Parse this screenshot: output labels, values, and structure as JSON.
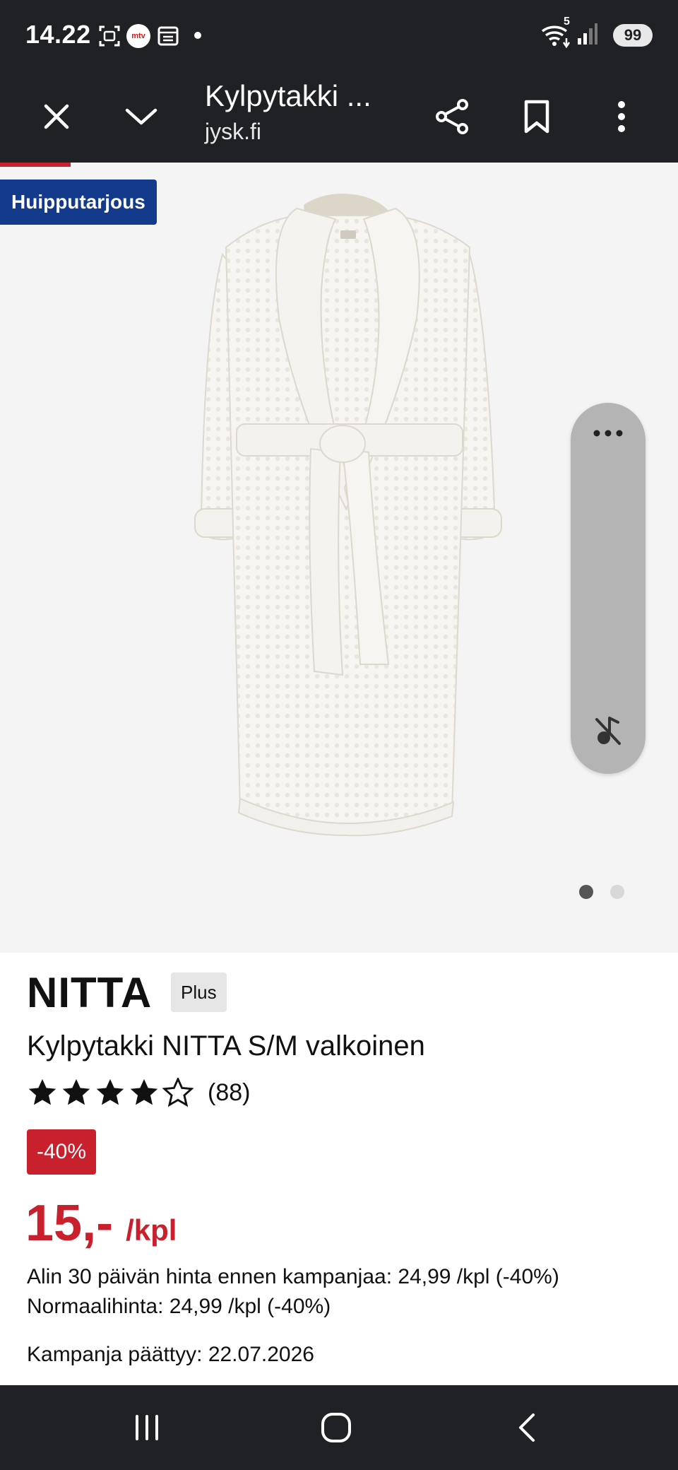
{
  "status_bar": {
    "time": "14.22",
    "icons": [
      "screenshot-icon",
      "mtv-app-icon",
      "calendar-icon",
      "notification-dot"
    ],
    "mtv_label": "mtv",
    "right_icons": [
      "wifi-icon",
      "signal-icon"
    ],
    "wifi_label": "5",
    "battery": "99"
  },
  "toolbar": {
    "title": "Kylpytakki ...",
    "url": "jysk.fi",
    "buttons": [
      "close-icon",
      "chevron-down-icon",
      "share-icon",
      "bookmark-icon",
      "more-vert-icon"
    ]
  },
  "gallery": {
    "promo_badge": "Huipputarjous",
    "image_desc_icon": "bathrobe-image",
    "side_panel_icons": [
      "more-horiz-icon",
      "music-off-icon"
    ],
    "page_count": 2,
    "active_page": 1
  },
  "product": {
    "brand": "NITTA",
    "tier_badge": "Plus",
    "name": "Kylpytakki NITTA S/M valkoinen",
    "rating": 4,
    "rating_max": 5,
    "review_count": "(88)",
    "discount_badge": "-40%",
    "price": "15,-",
    "price_unit": "/kpl",
    "lowest_30_days": "Alin 30 päivän hinta ennen kampanjaa: 24,99 /kpl (-40%)",
    "normal_price": "Normaalihinta: 24,99 /kpl (-40%)",
    "campaign_end": "Kampanja päättyy: 22.07.2026"
  },
  "colors": {
    "dark_bar": "#202124",
    "sale_red": "#c8202c",
    "promo_blue": "#143a8c",
    "gallery_bg": "#f4f4f4"
  },
  "nav_bar": {
    "buttons": [
      "recents-icon",
      "home-icon",
      "back-icon"
    ]
  }
}
